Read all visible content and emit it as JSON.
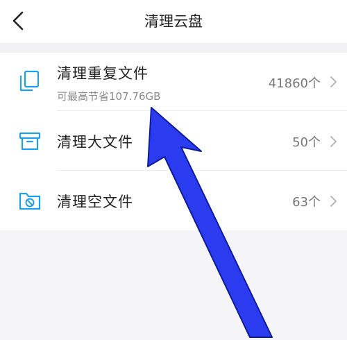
{
  "header": {
    "title": "清理云盘"
  },
  "items": [
    {
      "title": "清理重复文件",
      "subtitle": "可最高节省107.76GB",
      "count": "41860个",
      "icon": "duplicate-files-icon"
    },
    {
      "title": "清理大文件",
      "count": "50个",
      "icon": "archive-box-icon"
    },
    {
      "title": "清理空文件",
      "count": "63个",
      "icon": "empty-folder-icon"
    }
  ],
  "colors": {
    "accent": "#1ea0e6",
    "annotation_arrow": "#2b3cf0",
    "background": "#f5f5f7",
    "surface": "#ffffff"
  }
}
